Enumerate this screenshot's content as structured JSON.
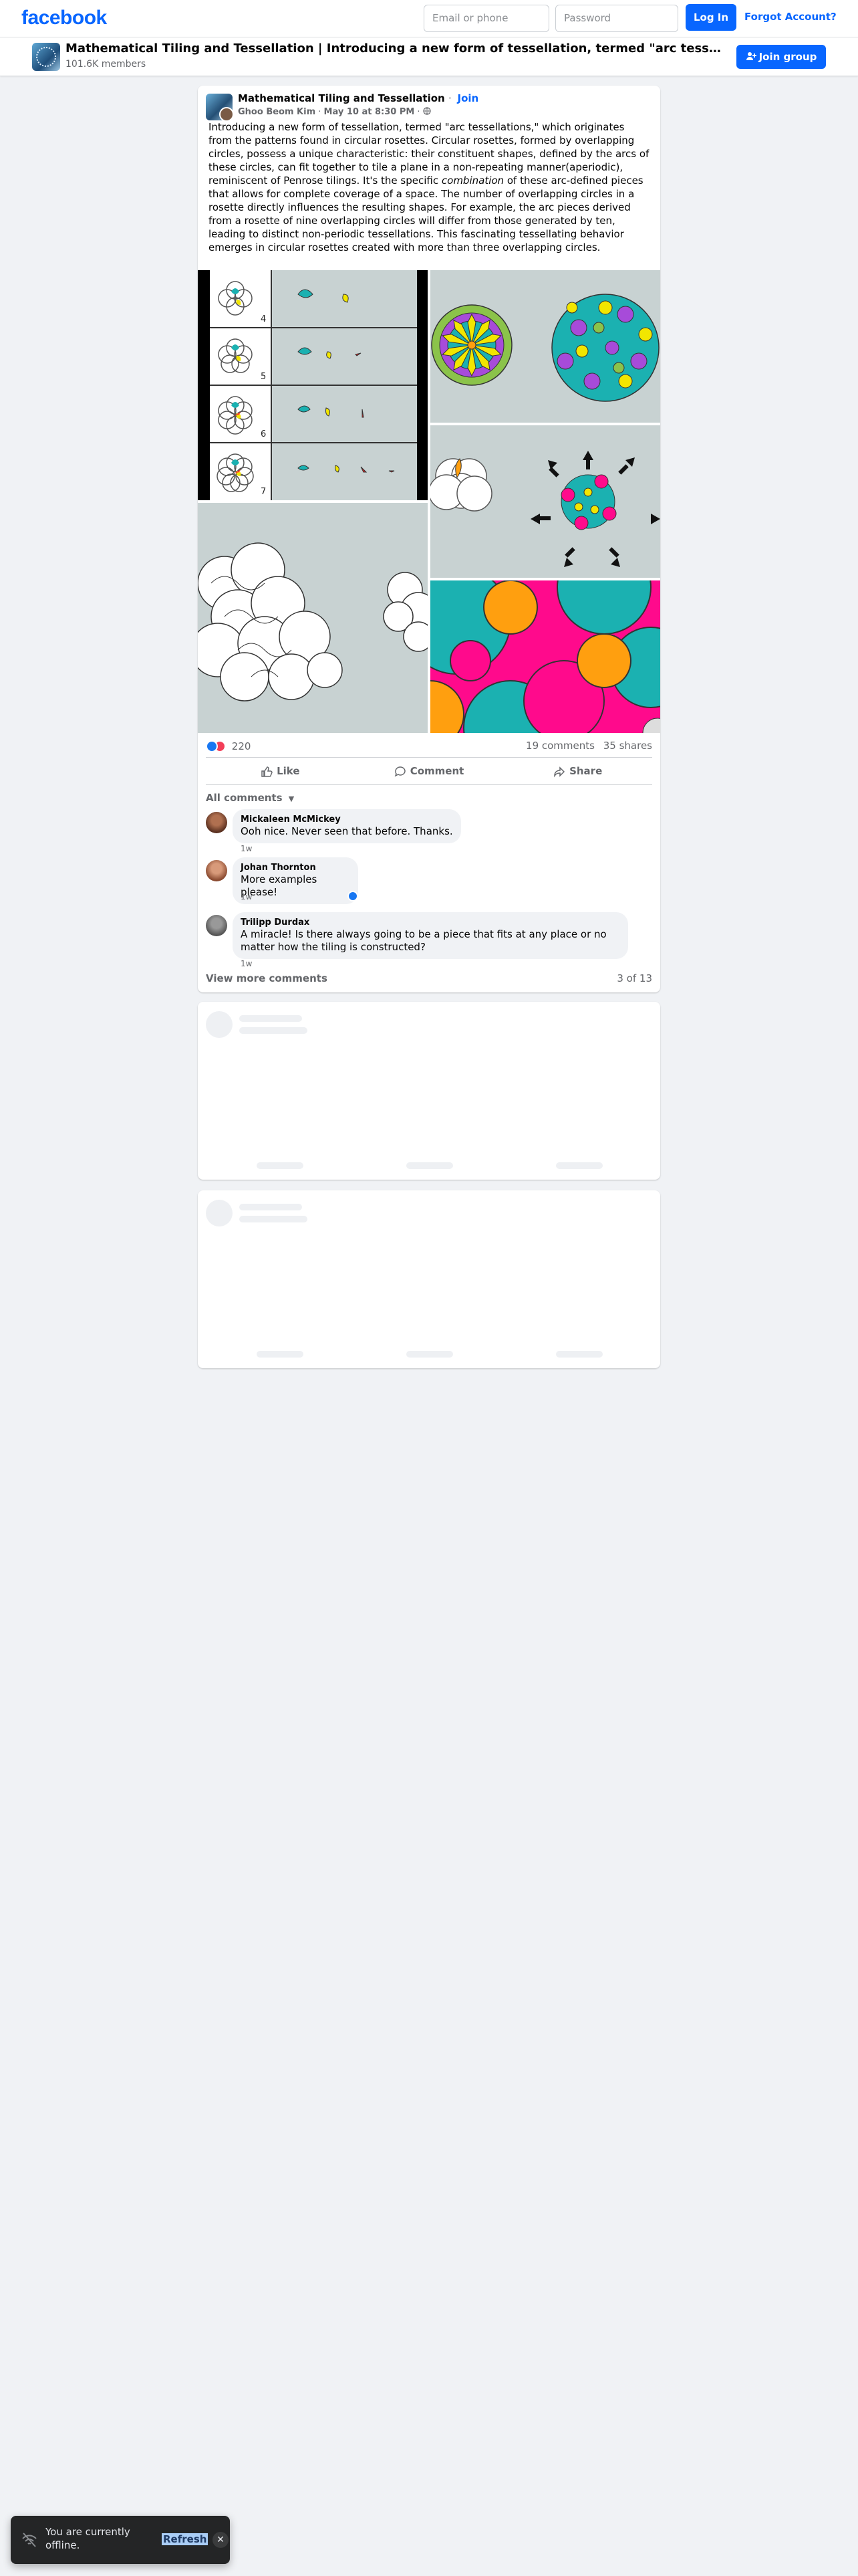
{
  "topbar": {
    "brand": "facebook",
    "email_placeholder": "Email or phone",
    "password_placeholder": "Password",
    "login_label": "Log In",
    "forgot_label": "Forgot Account?"
  },
  "group": {
    "title": "Mathematical Tiling and Tessellation | Introducing a new form of tessellation, termed \"arc tessellations,\" which originates from the patterns found in circular rosettes.",
    "members": "101.6K members",
    "join_label": "Join group"
  },
  "post": {
    "group_name": "Mathematical Tiling and Tessellation",
    "join_link": "Join",
    "author": "Ghoo Beom Kim",
    "date": "May 10 at 8:30 PM",
    "text_part1": "Introducing a new form of tessellation, termed \"arc tessellations,\" which originates from the patterns found in circular rosettes. Circular rosettes, formed by overlapping circles, possess a unique characteristic: their constituent shapes, defined by the arcs of these circles, can fit together to tile a plane in a non-repeating manner(aperiodic), reminiscent of Penrose tilings. It's the specific",
    "text_emph": "combination",
    "text_part2": "of these arc-defined pieces that allows for complete coverage of a space. The number of overlapping circles in a rosette directly influences the resulting shapes. For example, the arc pieces derived from a rosette of nine overlapping circles will differ from those generated by ten, leading to distinct non-periodic tessellations. This fascinating tessellating behavior emerges in circular rosettes created with more than three overlapping circles.",
    "rosette_labels": [
      "4",
      "5",
      "6",
      "7"
    ],
    "reaction_count": "220",
    "comments_count": "19 comments",
    "shares_count": "35 shares",
    "actions": {
      "like": "Like",
      "comment": "Comment",
      "share": "Share"
    },
    "all_comments_label": "All comments",
    "comments": [
      {
        "name": "Mickaleen McMickey",
        "text": "Ooh nice. Never seen that before. Thanks.",
        "time": "1w"
      },
      {
        "name": "Johan Thornton",
        "text": "More examples please!",
        "time": "1w"
      },
      {
        "name": "Trilipp Durdax",
        "text": "A miracle! Is there always going to be a piece that fits at any place or no matter how the tiling is constructed?",
        "time": "1w"
      }
    ],
    "view_more_label": "View more comments",
    "comments_shown": "3 of 13"
  },
  "toast": {
    "message": "You are currently offline.",
    "refresh_label": "Refresh"
  },
  "colors": {
    "brand_blue": "#0866ff",
    "teal": "#1bb1b1",
    "magenta": "#ff0a8c",
    "orange": "#ff9f0f",
    "yellow": "#f2e600",
    "purple": "#a74bd9",
    "tile_bg": "#c8d2d2"
  }
}
